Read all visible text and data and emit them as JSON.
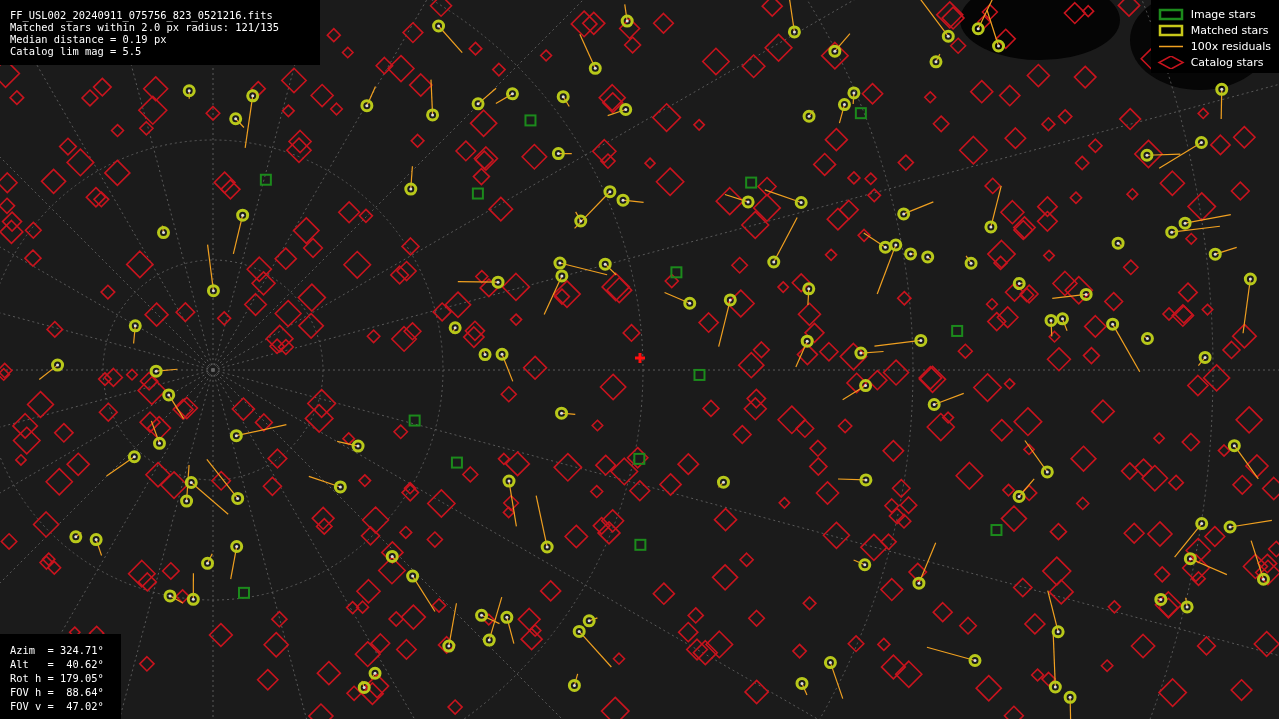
{
  "info_box": {
    "lines": [
      "FF_USL002_20240911_075756_823_0521216.fits",
      "Matched stars within 2.0 px radius: 121/135",
      "Median distance = 0.19 px",
      "Catalog lim mag = 5.5"
    ]
  },
  "pointing_box": {
    "lines": [
      "Azim  = 324.71°",
      "Alt   =  40.62°",
      "Rot h = 179.05°",
      "FOV h =  88.64°",
      "FOV v =  47.02°"
    ]
  },
  "legend": [
    {
      "kind": "image",
      "label": "Image stars"
    },
    {
      "kind": "matched",
      "label": "Matched stars"
    },
    {
      "kind": "residual",
      "label": "100x residuals"
    },
    {
      "kind": "catalog",
      "label": "Catalog stars"
    }
  ]
}
